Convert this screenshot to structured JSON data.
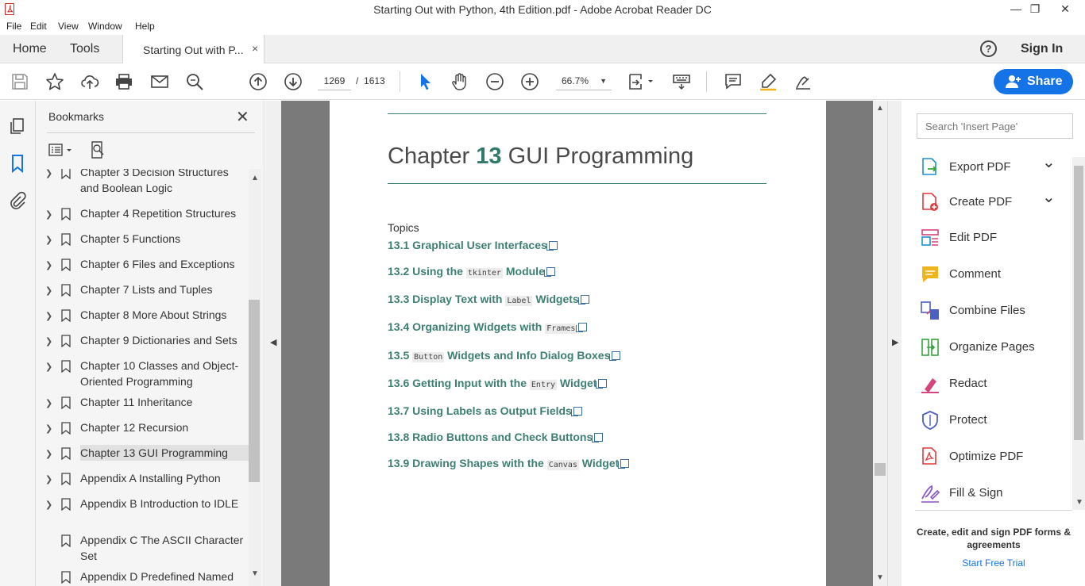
{
  "window": {
    "title": "Starting Out with Python, 4th Edition.pdf - Adobe Acrobat Reader DC",
    "controls": {
      "minimize": "—",
      "maximize": "❐",
      "close": "✕"
    }
  },
  "menu": [
    "File",
    "Edit",
    "View",
    "Window",
    "Help"
  ],
  "tabs": {
    "home": "Home",
    "tools": "Tools",
    "document": "Starting Out with P...",
    "close_glyph": "×",
    "help_glyph": "?",
    "sign_in": "Sign In"
  },
  "toolbar": {
    "current_page": "1269",
    "page_separator": "/",
    "total_pages": "1613",
    "zoom": "66.7%",
    "share_label": "Share"
  },
  "bookmarks": {
    "title": "Bookmarks",
    "close_glyph": "✕",
    "items": [
      {
        "label": "Chapter 3 Decision Structures and Boolean Logic",
        "expandable": true
      },
      {
        "label": "Chapter 4 Repetition Structures",
        "expandable": true
      },
      {
        "label": "Chapter 5 Functions",
        "expandable": true
      },
      {
        "label": "Chapter 6 Files and Exceptions",
        "expandable": true
      },
      {
        "label": "Chapter 7 Lists and Tuples",
        "expandable": true
      },
      {
        "label": "Chapter 8 More About Strings",
        "expandable": true
      },
      {
        "label": "Chapter 9 Dictionaries and Sets",
        "expandable": true
      },
      {
        "label": "Chapter 10 Classes and Object-Oriented Programming",
        "expandable": true
      },
      {
        "label": "Chapter 11 Inheritance",
        "expandable": true
      },
      {
        "label": "Chapter 12 Recursion",
        "expandable": true
      },
      {
        "label": "Chapter 13 GUI Programming",
        "expandable": true,
        "selected": true
      },
      {
        "label": "Appendix A Installing Python",
        "expandable": true
      },
      {
        "label": "Appendix B Introduction to IDLE",
        "expandable": true
      },
      {
        "label": "Appendix C The ASCII Character Set",
        "expandable": false
      },
      {
        "label": "Appendix D Predefined Named",
        "expandable": false
      }
    ]
  },
  "document": {
    "chapter_word": "Chapter",
    "chapter_number": "13",
    "chapter_title": "GUI Programming",
    "topics_heading": "Topics",
    "toc": [
      {
        "num": "13.1",
        "parts": [
          {
            "t": "Graphical User Interfaces"
          }
        ]
      },
      {
        "num": "13.2",
        "parts": [
          {
            "t": "Using the"
          },
          {
            "code": "tkinter"
          },
          {
            "t": "Module"
          }
        ]
      },
      {
        "num": "13.3",
        "parts": [
          {
            "t": "Display Text with"
          },
          {
            "code": "Label"
          },
          {
            "t": "Widgets"
          }
        ]
      },
      {
        "num": "13.4",
        "parts": [
          {
            "t": "Organizing Widgets with"
          },
          {
            "code": "Frames"
          }
        ]
      },
      {
        "num": "13.5",
        "parts": [
          {
            "code": "Button"
          },
          {
            "t": "Widgets and Info Dialog Boxes"
          }
        ]
      },
      {
        "num": "13.6",
        "parts": [
          {
            "t": "Getting Input with the"
          },
          {
            "code": "Entry"
          },
          {
            "t": "Widget"
          }
        ]
      },
      {
        "num": "13.7",
        "parts": [
          {
            "t": "Using Labels as Output Fields"
          }
        ]
      },
      {
        "num": "13.8",
        "parts": [
          {
            "t": "Radio Buttons and Check Buttons"
          }
        ]
      },
      {
        "num": "13.9",
        "parts": [
          {
            "t": "Drawing Shapes with the"
          },
          {
            "code": "Canvas"
          },
          {
            "t": "Widget"
          }
        ]
      }
    ]
  },
  "tools_panel": {
    "search_placeholder": "Search 'Insert Page'",
    "tools": [
      {
        "label": "Export PDF",
        "icon": "export-pdf-icon",
        "dropdown": true,
        "color": "#1d8fd1"
      },
      {
        "label": "Create PDF",
        "icon": "create-pdf-icon",
        "dropdown": true,
        "color": "#e0393e"
      },
      {
        "label": "Edit PDF",
        "icon": "edit-pdf-icon",
        "dropdown": false,
        "color": "#d5447d"
      },
      {
        "label": "Comment",
        "icon": "comment-icon",
        "dropdown": false,
        "color": "#f0b41c"
      },
      {
        "label": "Combine Files",
        "icon": "combine-files-icon",
        "dropdown": false,
        "color": "#4d5fc1"
      },
      {
        "label": "Organize Pages",
        "icon": "organize-pages-icon",
        "dropdown": false,
        "color": "#37a33d"
      },
      {
        "label": "Redact",
        "icon": "redact-icon",
        "dropdown": false,
        "color": "#d5447d"
      },
      {
        "label": "Protect",
        "icon": "protect-icon",
        "dropdown": false,
        "color": "#4d5fc1"
      },
      {
        "label": "Optimize PDF",
        "icon": "optimize-pdf-icon",
        "dropdown": false,
        "color": "#e0393e"
      },
      {
        "label": "Fill & Sign",
        "icon": "fill-sign-icon",
        "dropdown": false,
        "color": "#8a56c9"
      }
    ],
    "promo": "Create, edit and sign PDF forms & agreements",
    "trial_link": "Start Free Trial"
  },
  "colors": {
    "accent": "#1473e6",
    "chapter_green": "#2f7a6b",
    "toc_green": "#3d7f72"
  }
}
